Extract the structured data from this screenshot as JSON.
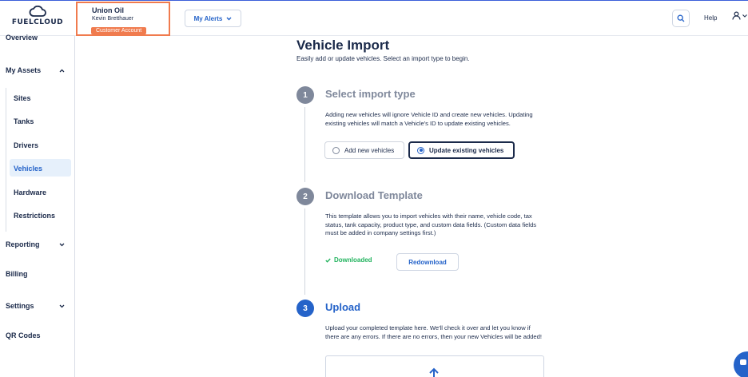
{
  "logo": {
    "text": "FUELCLOUD"
  },
  "account": {
    "company": "Union Oil",
    "user": "Kevin Bretthauer",
    "badge": "Customer Account"
  },
  "header": {
    "alerts_label": "My Alerts",
    "help_label": "Help"
  },
  "sidebar": {
    "overview": "Overview",
    "my_assets": "My Assets",
    "assets_items": [
      {
        "label": "Sites"
      },
      {
        "label": "Tanks"
      },
      {
        "label": "Drivers"
      },
      {
        "label": "Vehicles",
        "active": true
      },
      {
        "label": "Hardware"
      },
      {
        "label": "Restrictions"
      }
    ],
    "reporting": "Reporting",
    "billing": "Billing",
    "settings": "Settings",
    "qr_codes": "QR Codes"
  },
  "page": {
    "title": "Vehicle Import",
    "subtitle": "Easily add or update vehicles. Select an import type to begin."
  },
  "steps": [
    {
      "number": "1",
      "title": "Select import type",
      "text": "Adding new vehicles will ignore Vehicle ID and create new vehicles. Updating existing vehicles will match a Vehicle's ID to update existing vehicles.",
      "options": [
        {
          "label": "Add new vehicles",
          "selected": false
        },
        {
          "label": "Update existing vehicles",
          "selected": true
        }
      ]
    },
    {
      "number": "2",
      "title": "Download Template",
      "text": "This template allows you to import vehicles with their name, vehicle code, tax status, tank capacity, product type, and custom data fields. (Custom data fields must be added in company settings first.)",
      "status": "Downloaded",
      "button": "Redownload"
    },
    {
      "number": "3",
      "title": "Upload",
      "text": "Upload your completed template here. We'll check it over and let you know if there are any errors. If there are no errors, then your new Vehicles will be added!"
    }
  ],
  "colors": {
    "accent": "#2563c9",
    "highlight": "#f07b4e",
    "success": "#22b35e",
    "muted": "#7f889b",
    "text": "#1b2a4a"
  }
}
